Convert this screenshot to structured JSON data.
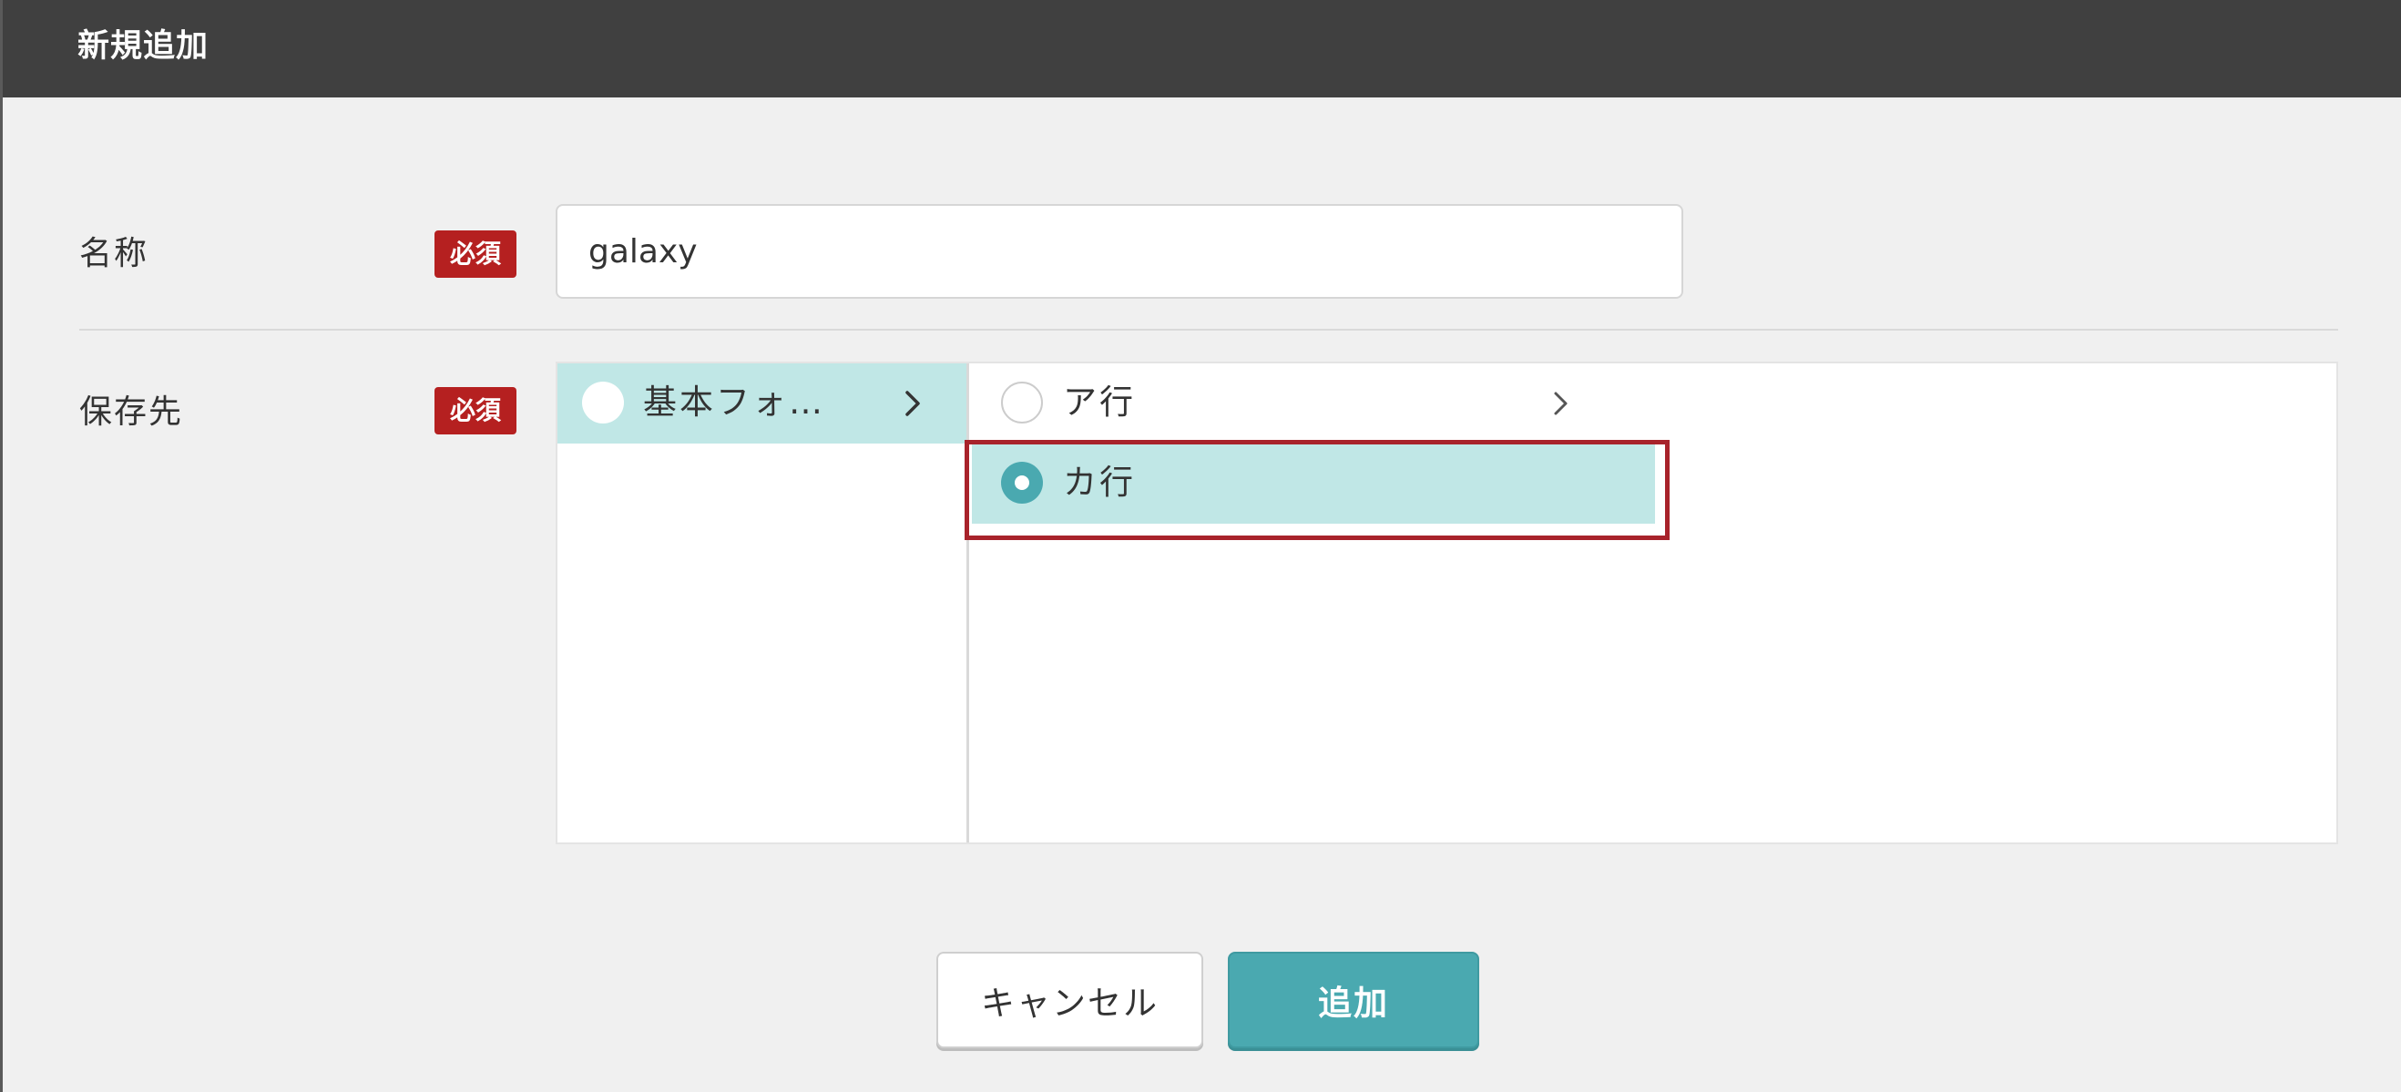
{
  "dialog": {
    "title": "新規追加"
  },
  "form": {
    "name": {
      "label": "名称",
      "required_badge": "必須",
      "value": "galaxy"
    },
    "destination": {
      "label": "保存先",
      "required_badge": "必須",
      "level1": [
        {
          "label": "基本フォ…",
          "selected": true,
          "has_children": true
        }
      ],
      "level2": [
        {
          "label": "ア行",
          "selected": false,
          "has_children": true
        },
        {
          "label": "カ行",
          "selected": true,
          "has_children": false
        }
      ]
    }
  },
  "buttons": {
    "cancel_label": "キャンセル",
    "add_label": "追加"
  },
  "colors": {
    "header_bg": "#404040",
    "required_badge": "#b52020",
    "accent": "#4aa9b0",
    "selected_row": "#c0e7e6",
    "highlight_border": "#a8232b"
  }
}
